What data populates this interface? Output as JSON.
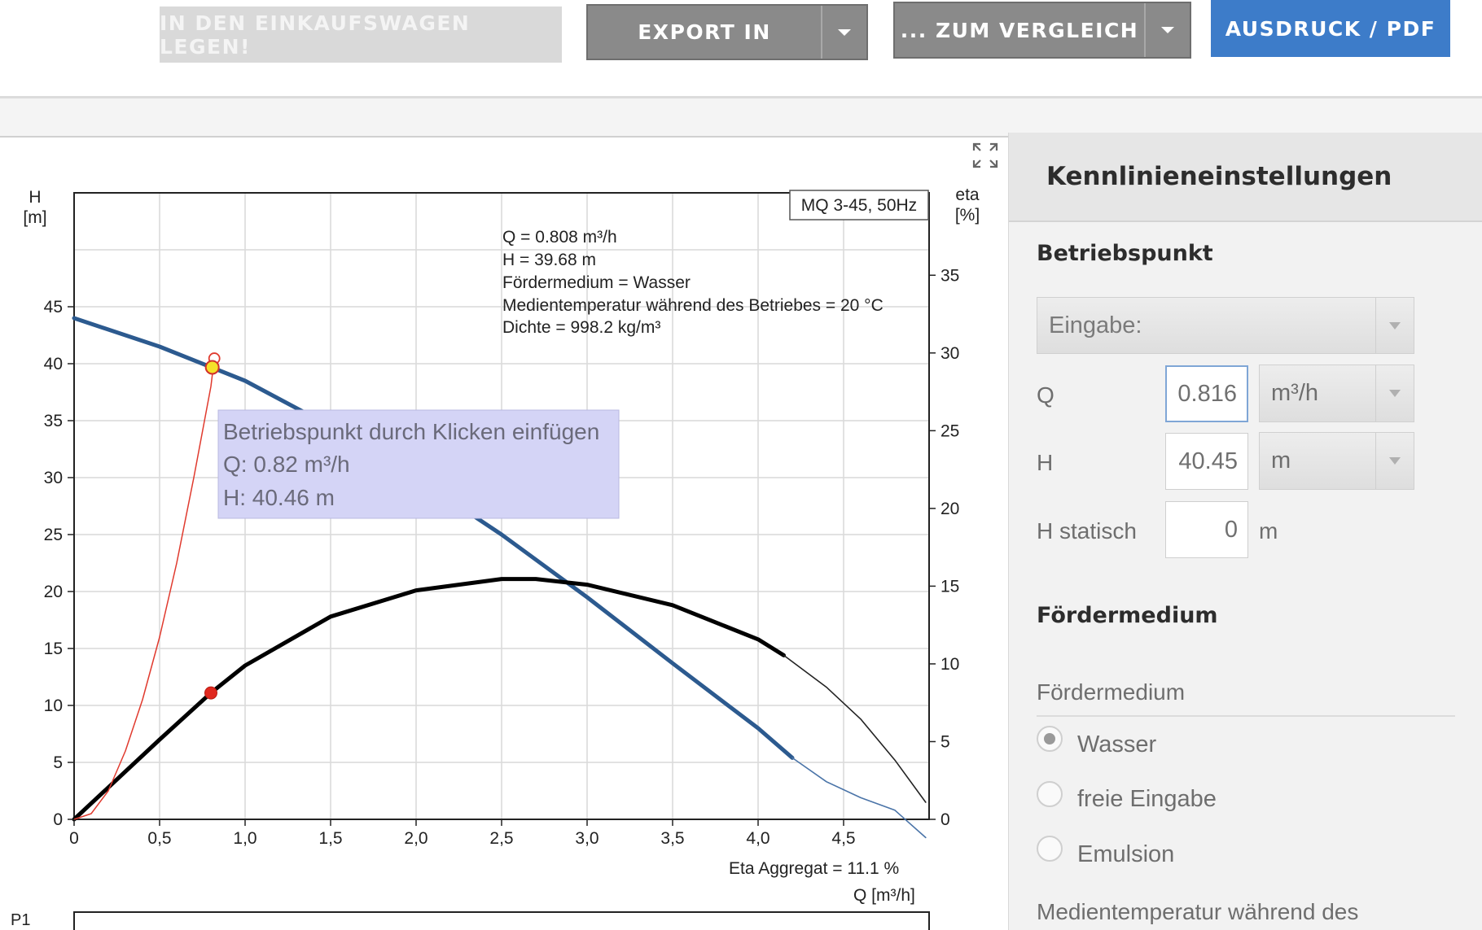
{
  "toolbar": {
    "cart": "IN DEN EINKAUFSWAGEN LEGEN!",
    "export": "EXPORT IN",
    "compare": "... ZUM VERGLEICH",
    "pdf": "AUSDRUCK / PDF"
  },
  "colors": {
    "accent_blue": "#3d7cc9",
    "curve_h": "#2c5a8f",
    "curve_eta": "#000000",
    "system_curve": "#e03a2e",
    "tooltip_bg": "#d4d4f6"
  },
  "chart": {
    "pump_label": "MQ 3-45, 50Hz",
    "left_axis_title_1": "H",
    "left_axis_title_2": "[m]",
    "right_axis_title_1": "eta",
    "right_axis_title_2": "[%]",
    "x_axis_title": "Q [m³/h]",
    "bottom_label": "P1",
    "info_lines": [
      "Q = 0.808 m³/h",
      "H = 39.68 m",
      "Fördermedium = Wasser",
      "Medientemperatur während des Betriebes = 20 °C",
      "Dichte = 998.2 kg/m³"
    ],
    "eta_note": "Eta Aggregat = 11.1 %",
    "tooltip_lines": [
      "Betriebspunkt durch Klicken einfügen",
      "Q: 0.82 m³/h",
      "H: 40.46 m"
    ]
  },
  "chart_data": {
    "type": "line",
    "xlabel": "Q [m³/h]",
    "ylabel": "H [m]",
    "y2label": "eta [%]",
    "x_ticks": [
      "0",
      "0,5",
      "1,0",
      "1,5",
      "2,0",
      "2,5",
      "3,0",
      "3,5",
      "4,0",
      "4,5"
    ],
    "y_ticks": [
      "0",
      "5",
      "10",
      "15",
      "20",
      "25",
      "30",
      "35",
      "40",
      "45"
    ],
    "y2_ticks": [
      "0",
      "5",
      "10",
      "15",
      "20",
      "25",
      "30",
      "35"
    ],
    "xlim": [
      0,
      5
    ],
    "ylim": [
      0,
      55
    ],
    "y2lim": [
      0,
      40.3
    ],
    "series": [
      {
        "x": [
          0,
          0.5,
          1.0,
          1.5,
          2.0,
          2.5,
          3.0,
          3.5,
          4.0,
          4.2
        ],
        "y": [
          44,
          41.5,
          38.5,
          34.5,
          30,
          25,
          19.5,
          13.7,
          8,
          5.4
        ]
      },
      {
        "x": [
          4.2,
          4.4,
          4.6,
          4.8,
          4.98
        ],
        "y": [
          5.4,
          3.3,
          1.9,
          0.8,
          -1.6
        ]
      },
      {
        "x": [
          0,
          0.5,
          0.8,
          1.0,
          1.5,
          2.0,
          2.5,
          2.7,
          3.0,
          3.5,
          4.0,
          4.15
        ],
        "y": [
          0,
          7,
          11.1,
          13.5,
          17.8,
          20.1,
          21.1,
          21.1,
          20.6,
          18.8,
          15.8,
          14.4
        ]
      },
      {
        "x": [
          4.15,
          4.4,
          4.6,
          4.8,
          4.98
        ],
        "y": [
          14.4,
          11.6,
          8.8,
          5.2,
          1.5
        ]
      },
      {
        "x": [
          0,
          0.1,
          0.2,
          0.3,
          0.4,
          0.5,
          0.6,
          0.7,
          0.8,
          0.82
        ],
        "y": [
          0,
          0.5,
          2.5,
          6,
          10.5,
          16,
          22.5,
          30,
          38,
          40.46
        ]
      }
    ],
    "points": [
      {
        "x": 0.82,
        "y": 40.46
      },
      {
        "x": 0.808,
        "y": 39.68
      },
      {
        "x": 0.8,
        "y": 11.1
      }
    ]
  },
  "panel": {
    "title": "Kennlinieneinstellungen",
    "op_section": "Betriebspunkt",
    "input_select": "Eingabe:",
    "q_label": "Q",
    "q_value": "0.816",
    "q_unit": "m³/h",
    "h_label": "H",
    "h_value": "40.45",
    "h_unit": "m",
    "hs_label": "H statisch",
    "hs_value": "0",
    "hs_unit": "m",
    "medium_section": "Fördermedium",
    "medium_label": "Fördermedium",
    "radio_water": "Wasser",
    "radio_free": "freie Eingabe",
    "radio_emulsion": "Emulsion",
    "temp_label": "Medientemperatur während des"
  }
}
